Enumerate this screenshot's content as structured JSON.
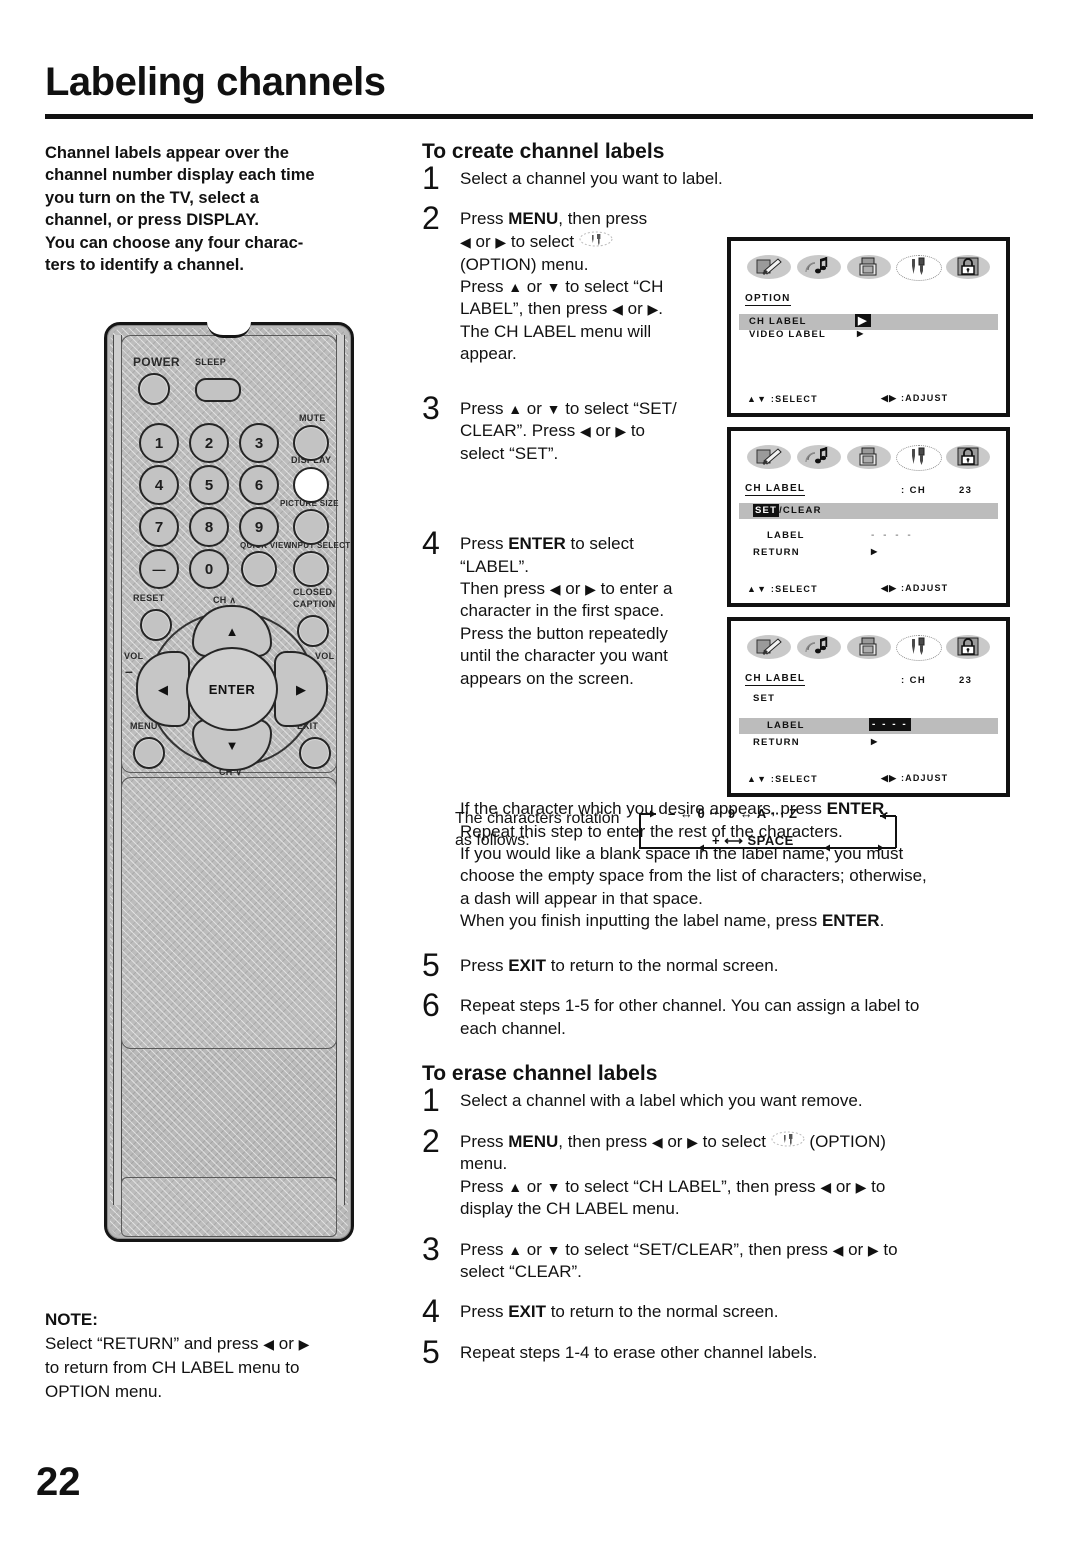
{
  "page": {
    "title": "Labeling channels",
    "number": "22"
  },
  "intro": {
    "text": "Channel labels appear over the channel number display each time you turn on the TV, select a channel, or press DISPLAY. You can choose any four characters to identify a channel.",
    "lines": [
      "Channel labels appear over the",
      "channel number display each time",
      "you turn on the TV, select a",
      "channel, or press DISPLAY.",
      "You can choose any four charac-",
      "ters to identify a channel."
    ]
  },
  "remote": {
    "labels": {
      "power": "POWER",
      "sleep": "SLEEP",
      "mute": "MUTE",
      "display": "DISPLAY",
      "picture_size": "PICTURE SIZE",
      "quick_view": "QUICK VIEW",
      "input_select": "INPUT SELECT",
      "reset": "RESET",
      "ch_up": "CH ∧",
      "ch_down": "CH ∨",
      "closed_caption_1": "CLOSED",
      "closed_caption_2": "CAPTION",
      "vol_left": "VOL",
      "vol_left_sign": "–",
      "vol_right": "VOL",
      "vol_right_sign": "+",
      "menu": "MENU",
      "exit": "EXIT",
      "enter": "ENTER"
    },
    "keypad": [
      "1",
      "2",
      "3",
      "4",
      "5",
      "6",
      "7",
      "8",
      "9",
      "—",
      "0"
    ]
  },
  "note": {
    "heading": "NOTE:",
    "line1_a": "Select “RETURN” and press ",
    "line1_b": " or ",
    "line2": "to return from CH LABEL menu to",
    "line3": "OPTION menu."
  },
  "create": {
    "heading": "To create channel labels",
    "steps": [
      {
        "num": "1",
        "text": "Select a channel you want to label."
      },
      {
        "num": "2",
        "text": "Press MENU, then press ◀ or ▶ to select (OPTION) menu. Press ▲ or ▼ to select “CH LABEL”, then press ◀ or ▶. The CH LABEL menu will appear."
      },
      {
        "num": "3",
        "text": "Press ▲ or ▼ to select “SET/CLEAR”. Press ◀ or ▶ to select “SET”."
      },
      {
        "num": "4",
        "text": "Press ENTER to select “LABEL”. Then press ◀ or ▶ to enter a character in the first space. Press the button repeatedly until the character you want appears on the screen."
      },
      {
        "num": "5",
        "text": "Press EXIT to return to the normal screen."
      },
      {
        "num": "6",
        "text": "Repeat steps 1-5 for other channel. You can assign a label to each channel."
      }
    ]
  },
  "rotation": {
    "caption_l1": "The characters rotation",
    "caption_l2": "as follows:",
    "top_row": "–   ↔   0 ··· 9   ↔   A ··· Z",
    "bottom_row": "+   ⟷   SPACE"
  },
  "body_paragraph": {
    "lines": [
      "If the character which you desire appears, press ENTER.",
      "Repeat this step to enter the rest of the characters.",
      "If you would like a blank space in the label name, you must",
      "choose the empty space from the list of characters; otherwise,",
      "a dash will appear in that space.",
      "When you finish inputting the label name, press ENTER."
    ]
  },
  "erase": {
    "heading": "To erase channel labels",
    "steps": [
      {
        "num": "1",
        "text": "Select a channel with a label which you want remove."
      },
      {
        "num": "2",
        "text": "Press MENU, then press ◀ or ▶ to select (OPTION) menu. Press ▲ or ▼ to select “CH LABEL”, then press ◀ or ▶ to display the CH LABEL menu."
      },
      {
        "num": "3",
        "text": "Press ▲ or ▼ to select “SET/CLEAR”, then press ◀ or ▶ to select “CLEAR”."
      },
      {
        "num": "4",
        "text": "Press EXIT to return to the normal screen."
      },
      {
        "num": "5",
        "text": "Repeat steps 1-4 to erase other channel labels."
      }
    ]
  },
  "osd": {
    "icons": [
      "paintbrush-picture-icon",
      "music-note-audio-icon",
      "tv-setup-icon",
      "tools-option-icon",
      "lock-parental-icon"
    ],
    "footer_select": "▲▼ :SELECT",
    "footer_adjust": "◀▶ :ADJUST",
    "screen1": {
      "title": "OPTION",
      "row1": "CH LABEL",
      "row1_marker": "▶",
      "row2": "VIDEO LABEL",
      "row2_marker": "▶"
    },
    "screen2": {
      "title": "CH LABEL",
      "channel_prefix": ": CH",
      "channel_number": "23",
      "row_set": "SET",
      "row_setclear_rest": "/CLEAR",
      "row_label": "LABEL",
      "label_value": "- - - -",
      "row_return": "RETURN",
      "return_marker": "▶"
    },
    "screen3": {
      "title": "CH LABEL",
      "channel_prefix": ": CH",
      "channel_number": "23",
      "row_set": "SET",
      "row_label": "LABEL",
      "label_value": "- - - -",
      "row_return": "RETURN",
      "return_marker": "▶"
    }
  },
  "colors": {
    "ink": "#111111",
    "osd_highlight": "#bcbcbc",
    "remote_body": "#b9b9b9"
  }
}
